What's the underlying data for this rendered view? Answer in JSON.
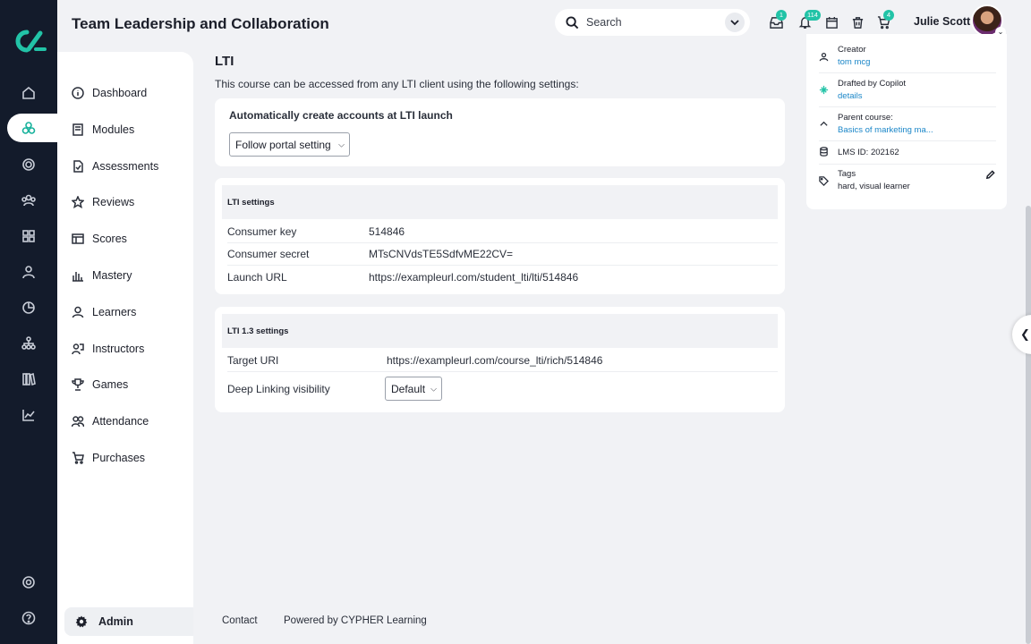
{
  "header": {
    "title": "Team Leadership and Collaboration",
    "search_placeholder": "Search",
    "inbox_count": "1",
    "notifications_count": "114",
    "cart_count": "4",
    "user_name": "Julie Scott"
  },
  "subnav": {
    "items": [
      {
        "label": "Dashboard",
        "icon": "info-icon"
      },
      {
        "label": "Modules",
        "icon": "book-icon"
      },
      {
        "label": "Assessments",
        "icon": "document-icon"
      },
      {
        "label": "Reviews",
        "icon": "star-icon"
      },
      {
        "label": "Scores",
        "icon": "table-icon"
      },
      {
        "label": "Mastery",
        "icon": "bar-chart-icon"
      },
      {
        "label": "Learners",
        "icon": "user-icon"
      },
      {
        "label": "Instructors",
        "icon": "instructor-icon"
      },
      {
        "label": "Games",
        "icon": "trophy-icon"
      },
      {
        "label": "Attendance",
        "icon": "people-icon"
      },
      {
        "label": "Purchases",
        "icon": "cart-icon"
      }
    ],
    "admin_label": "Admin"
  },
  "main": {
    "title": "LTI",
    "description": "This course can be accessed from any LTI client using the following settings:",
    "auto_create_label": "Automatically create accounts at LTI launch",
    "auto_create_value": "Follow portal setting",
    "lti_settings": {
      "heading": "LTI settings",
      "rows": [
        {
          "key": "Consumer key",
          "value": "514846"
        },
        {
          "key": "Consumer secret",
          "value": "MTsCNVdsTE5SdfvME22CV="
        },
        {
          "key": "Launch URL",
          "value": "https://exampleurl.com/student_lti/lti/514846"
        }
      ]
    },
    "lti13_settings": {
      "heading": "LTI 1.3 settings",
      "target_uri_label": "Target URI",
      "target_uri_value": "https://exampleurl.com/course_lti/rich/514846",
      "deep_linking_label": "Deep Linking visibility",
      "deep_linking_value": "Default"
    }
  },
  "info_panel": {
    "creator_label": "Creator",
    "creator_value": "tom mcg",
    "drafted_label": "Drafted by Copilot",
    "drafted_link": "details",
    "parent_label": "Parent course:",
    "parent_value": "Basics of marketing ma...",
    "lms_id": "LMS ID: 202162",
    "tags_label": "Tags",
    "tags_value": "hard, visual learner"
  },
  "footer": {
    "contact": "Contact",
    "powered_by": "Powered by CYPHER Learning"
  },
  "colors": {
    "rail_bg": "#131b2b",
    "accent": "#22c3a7",
    "link": "#1a86c8"
  }
}
